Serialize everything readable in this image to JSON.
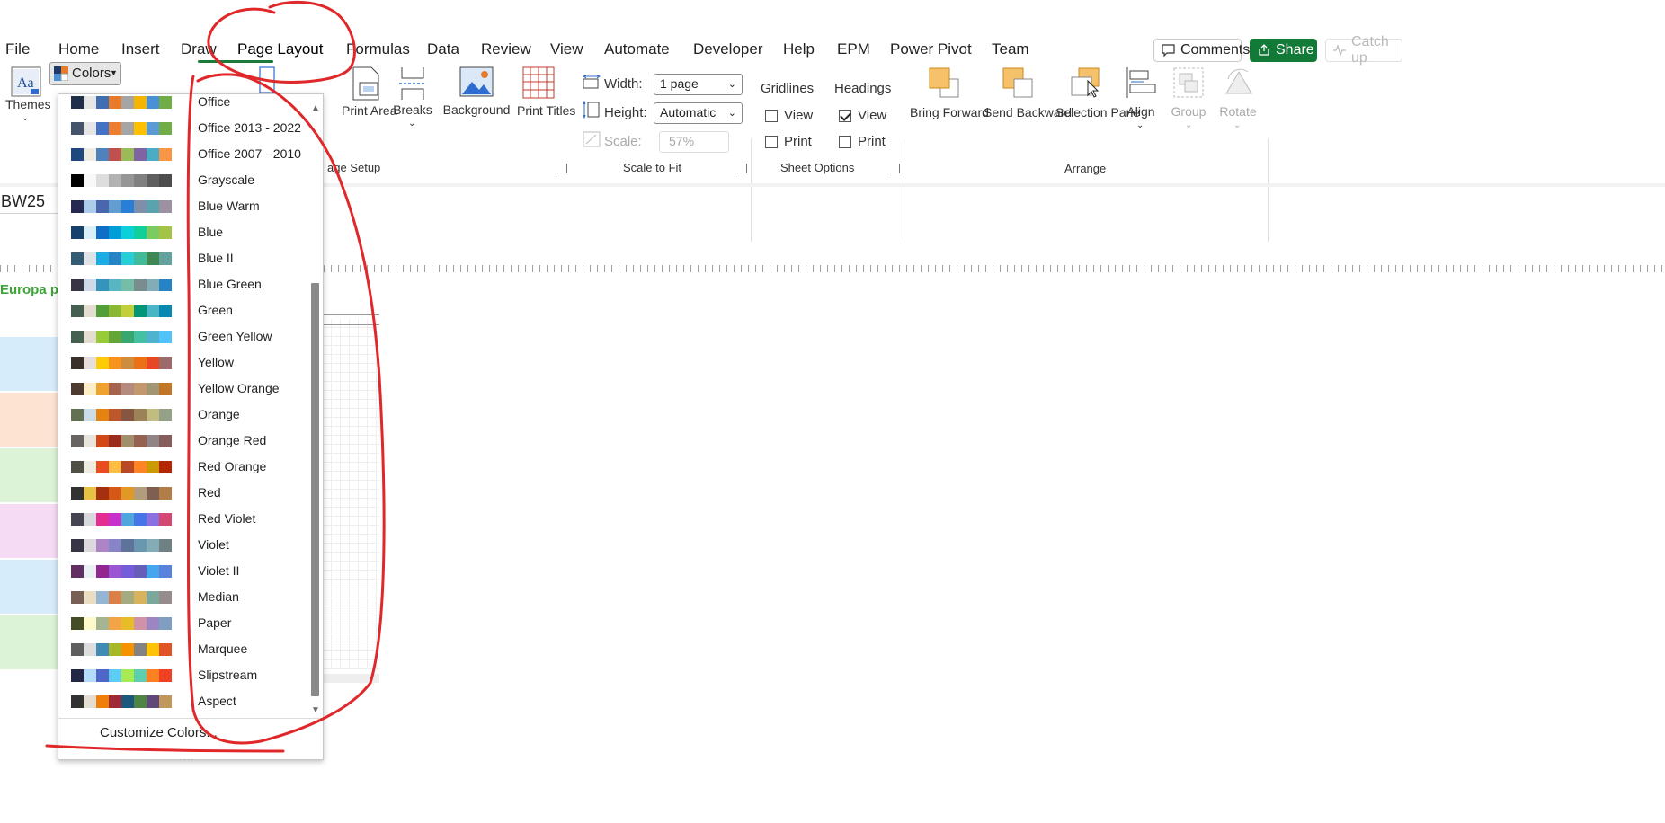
{
  "tabs": [
    "File",
    "Home",
    "Insert",
    "Draw",
    "Page Layout",
    "Formulas",
    "Data",
    "Review",
    "View",
    "Automate",
    "Developer",
    "Help",
    "EPM",
    "Power Pivot",
    "Team"
  ],
  "active_tab": "Page Layout",
  "topbar": {
    "comments": "Comments",
    "share": "Share",
    "catch_up": "Catch up"
  },
  "ribbon": {
    "themes": "Themes",
    "colors": "Colors",
    "print_area": "Print Area",
    "breaks": "Breaks",
    "background": "Background",
    "print_titles": "Print Titles",
    "page_setup_fragment": "age Setup",
    "page_fragment_e": "e",
    "width_label": "Width:",
    "width_value": "1 page",
    "height_label": "Height:",
    "height_value": "Automatic",
    "scale_label": "Scale:",
    "scale_value": "57%",
    "scale_group": "Scale to Fit",
    "gridlines": "Gridlines",
    "headings": "Headings",
    "view": "View",
    "print": "Print",
    "sheet_options": "Sheet Options",
    "bring_forward": "Bring Forward",
    "send_backward": "Send Backward",
    "selection_pane": "Selection Pane",
    "align": "Align",
    "group": "Group",
    "rotate": "Rotate",
    "arrange": "Arrange",
    "gridlines_view": false,
    "gridlines_print": false,
    "headings_view": true,
    "headings_print": false
  },
  "namebox": "BW25",
  "sheet_title_fragment": "Europa p",
  "colors_menu": {
    "items": [
      {
        "name": "Office",
        "colors": [
          "#1f2f4a",
          "#e7e6e6",
          "#3f6fb0",
          "#e97a2a",
          "#a5a5a5",
          "#f4b400",
          "#4a90d6",
          "#70ad47"
        ]
      },
      {
        "name": "Office 2013 - 2022",
        "colors": [
          "#44546a",
          "#e7e6e6",
          "#4472c4",
          "#ed7d31",
          "#a5a5a5",
          "#ffc000",
          "#5b9bd5",
          "#70ad47"
        ]
      },
      {
        "name": "Office 2007 - 2010",
        "colors": [
          "#1f497d",
          "#eeece1",
          "#4f81bd",
          "#c0504d",
          "#9bbb59",
          "#8064a2",
          "#4bacc6",
          "#f79646"
        ]
      },
      {
        "name": "Grayscale",
        "colors": [
          "#000000",
          "#f8f8f8",
          "#dddddd",
          "#b2b2b2",
          "#969696",
          "#808080",
          "#5f5f5f",
          "#4d4d4d"
        ]
      },
      {
        "name": "Blue Warm",
        "colors": [
          "#242852",
          "#acccea",
          "#4a66ac",
          "#629dd1",
          "#297fd5",
          "#7f8fa9",
          "#5aa2ae",
          "#9d90a0"
        ]
      },
      {
        "name": "Blue",
        "colors": [
          "#17406d",
          "#dbeff9",
          "#0f6fc6",
          "#009dd9",
          "#0bd0d9",
          "#10cf9b",
          "#7cca62",
          "#a5c249"
        ]
      },
      {
        "name": "Blue II",
        "colors": [
          "#335b74",
          "#dfe3e5",
          "#1cade4",
          "#2683c6",
          "#27ced7",
          "#42ba97",
          "#3e8853",
          "#62a39f"
        ]
      },
      {
        "name": "Blue Green",
        "colors": [
          "#373545",
          "#cedbe6",
          "#3494ba",
          "#58b6c0",
          "#75bda7",
          "#7a8c8e",
          "#84acb6",
          "#2683c6"
        ]
      },
      {
        "name": "Green",
        "colors": [
          "#455f51",
          "#e3ded1",
          "#549e39",
          "#8ab833",
          "#c0cf3a",
          "#029676",
          "#4ab5c4",
          "#0989b1"
        ]
      },
      {
        "name": "Green Yellow",
        "colors": [
          "#455f51",
          "#e3ded1",
          "#99cb38",
          "#63a537",
          "#37a76f",
          "#44c1a3",
          "#4eb3cf",
          "#51c3f9"
        ]
      },
      {
        "name": "Yellow",
        "colors": [
          "#39302a",
          "#e5dedb",
          "#ffca08",
          "#f8931d",
          "#ce8d3e",
          "#ec7016",
          "#e64823",
          "#9c6a6a"
        ]
      },
      {
        "name": "Yellow Orange",
        "colors": [
          "#4e3b30",
          "#fbeec9",
          "#f0a22e",
          "#a5644e",
          "#b58b80",
          "#c3986d",
          "#a19574",
          "#c17529"
        ]
      },
      {
        "name": "Orange",
        "colors": [
          "#637052",
          "#ccddea",
          "#e48312",
          "#bd582c",
          "#865640",
          "#9b8357",
          "#c2bc80",
          "#94a088"
        ]
      },
      {
        "name": "Orange Red",
        "colors": [
          "#696464",
          "#e9e5dc",
          "#d34817",
          "#9b2d1f",
          "#a28e6a",
          "#956251",
          "#918485",
          "#855d5d"
        ]
      },
      {
        "name": "Red Orange",
        "colors": [
          "#505046",
          "#eeece1",
          "#e84c22",
          "#ffbd47",
          "#b64926",
          "#ff8427",
          "#cc9900",
          "#b22600"
        ]
      },
      {
        "name": "Red",
        "colors": [
          "#323232",
          "#e5c243",
          "#a5300f",
          "#d55816",
          "#e19825",
          "#b19c7d",
          "#7f5f52",
          "#b27d49"
        ]
      },
      {
        "name": "Red Violet",
        "colors": [
          "#454551",
          "#d8d9dc",
          "#e32d91",
          "#c830cc",
          "#4ea6dc",
          "#4775e7",
          "#8971e1",
          "#d54773"
        ]
      },
      {
        "name": "Violet",
        "colors": [
          "#373545",
          "#dcd8dc",
          "#ad84c6",
          "#8784c7",
          "#5d739a",
          "#6997af",
          "#84acb6",
          "#6f8183"
        ]
      },
      {
        "name": "Violet II",
        "colors": [
          "#632e62",
          "#eaf0f3",
          "#92278f",
          "#9b57d3",
          "#755dd9",
          "#665eb8",
          "#45a5ed",
          "#5982db"
        ]
      },
      {
        "name": "Median",
        "colors": [
          "#775f55",
          "#ebddc3",
          "#94b6d2",
          "#dd8047",
          "#a5ab81",
          "#d8b25c",
          "#7ba79d",
          "#968c8c"
        ]
      },
      {
        "name": "Paper",
        "colors": [
          "#444d26",
          "#fefac9",
          "#a5b592",
          "#f3a447",
          "#e7bc29",
          "#d092a7",
          "#9c85c0",
          "#809ec2"
        ]
      },
      {
        "name": "Marquee",
        "colors": [
          "#5e5e5e",
          "#dddddd",
          "#418ab3",
          "#a6b727",
          "#f69200",
          "#838383",
          "#fec306",
          "#df5327"
        ]
      },
      {
        "name": "Slipstream",
        "colors": [
          "#212745",
          "#b4dcfa",
          "#4e67c8",
          "#5eccf3",
          "#a7ea52",
          "#5dceaf",
          "#ff8021",
          "#f14124"
        ]
      },
      {
        "name": "Aspect",
        "colors": [
          "#323232",
          "#e3ded1",
          "#f07f09",
          "#9f2936",
          "#1b587c",
          "#4e8542",
          "#604878",
          "#c19859"
        ]
      }
    ],
    "customize": "Customize Colors..."
  },
  "colors": {
    "accent_green": "#117a37",
    "annotation_red": "#e0282a"
  }
}
